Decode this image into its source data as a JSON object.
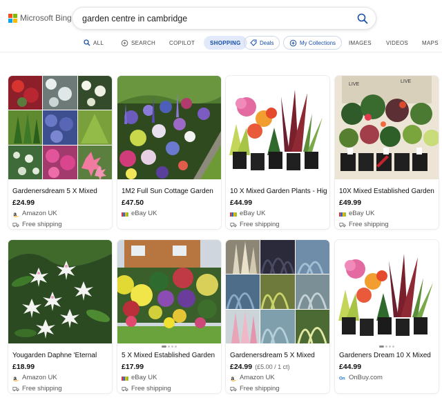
{
  "app": {
    "logo_text": "Microsoft Bing"
  },
  "search": {
    "query": "garden centre in cambridge"
  },
  "nav": {
    "all": "ALL",
    "search": "SEARCH",
    "copilot": "COPILOT",
    "shopping": "SHOPPING",
    "deals": "Deals",
    "collections": "My Collections",
    "images": "IMAGES",
    "videos": "VIDEOS",
    "maps": "MAPS"
  },
  "colors": {
    "accent": "#174ea6",
    "active_tab_bg": "#e1e9fb"
  },
  "products": [
    {
      "title": "Gardenersdream 5 X Mixed",
      "price": "£24.99",
      "unit_price": "",
      "seller": "Amazon UK",
      "seller_icon": "amazon-icon",
      "shipping": "Free shipping"
    },
    {
      "title": "1M2 Full Sun Cottage Garden",
      "price": "£47.50",
      "unit_price": "",
      "seller": "eBay UK",
      "seller_icon": "ebay-icon",
      "shipping": ""
    },
    {
      "title": "10 X Mixed Garden Plants - High",
      "price": "£44.99",
      "unit_price": "",
      "seller": "eBay UK",
      "seller_icon": "ebay-icon",
      "shipping": "Free shipping"
    },
    {
      "title": "10X Mixed Established Garden",
      "price": "£49.99",
      "unit_price": "",
      "seller": "eBay UK",
      "seller_icon": "ebay-icon",
      "shipping": "Free shipping"
    },
    {
      "title": "Yougarden Daphne 'Eternal",
      "price": "£18.99",
      "unit_price": "",
      "seller": "Amazon UK",
      "seller_icon": "amazon-icon",
      "shipping": "Free shipping"
    },
    {
      "title": "5 X Mixed Established Garden",
      "price": "£17.99",
      "unit_price": "",
      "seller": "eBay UK",
      "seller_icon": "ebay-icon",
      "shipping": "Free shipping"
    },
    {
      "title": "Gardenersdream 5 X Mixed",
      "price": "£24.99",
      "unit_price": "(£5.00 / 1 ct)",
      "seller": "Amazon UK",
      "seller_icon": "amazon-icon",
      "shipping": "Free shipping"
    },
    {
      "title": "Gardeners Dream 10 X Mixed",
      "price": "£44.99",
      "unit_price": "",
      "seller": "OnBuy.com",
      "seller_icon": "onbuy-icon",
      "shipping": ""
    }
  ]
}
